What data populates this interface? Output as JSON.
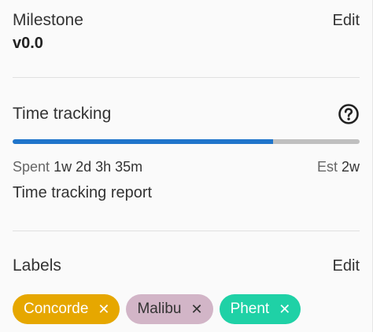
{
  "milestone": {
    "title": "Milestone",
    "edit_label": "Edit",
    "value": "v0.0"
  },
  "time_tracking": {
    "title": "Time tracking",
    "help_icon": "question-circle-icon",
    "progress_fraction": 0.75,
    "colors": {
      "fill": "#1f75cb",
      "track": "#bfbfbf"
    },
    "spent_label": "Spent",
    "spent_value": "1w 2d 3h 35m",
    "estimate_label": "Est",
    "estimate_value": "2w",
    "report_link": "Time tracking report"
  },
  "labels": {
    "title": "Labels",
    "edit_label": "Edit",
    "items": [
      {
        "name": "Concorde",
        "bg": "#e6a700",
        "fg": "#ffffff",
        "remove_icon": "close-icon"
      },
      {
        "name": "Malibu",
        "bg": "#d2b5c7",
        "fg": "#333333",
        "remove_icon": "close-icon"
      },
      {
        "name": "Phent",
        "bg": "#1fd1a6",
        "fg": "#ffffff",
        "remove_icon": "close-icon"
      }
    ],
    "remove_glyph": "✕"
  }
}
